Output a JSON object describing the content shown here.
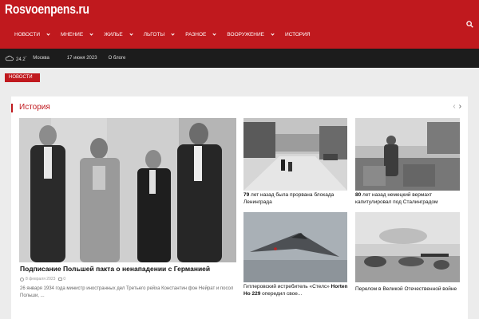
{
  "header": {
    "logo": "Rosvoenpens.ru",
    "nav": [
      {
        "label": "Новости",
        "has_submenu": true
      },
      {
        "label": "Мнение",
        "has_submenu": true
      },
      {
        "label": "Жилье",
        "has_submenu": true
      },
      {
        "label": "Льготы",
        "has_submenu": true
      },
      {
        "label": "Разное",
        "has_submenu": true
      },
      {
        "label": "Вооружение",
        "has_submenu": true
      },
      {
        "label": "История",
        "has_submenu": false
      }
    ],
    "search_icon": "search-icon"
  },
  "topbar": {
    "weather_icon": "cloud-icon",
    "temperature": "24.2",
    "degree": "°",
    "city": "Москва",
    "date": "17 июня 2023",
    "about": "О блоге"
  },
  "ticker": {
    "label": "Новости"
  },
  "section": {
    "title": "История",
    "prev_icon": "chevron-left-icon",
    "next_icon": "chevron-right-icon",
    "featured": {
      "title": "Подписание Польшей пакта о ненападении с Германией",
      "date": "8 февраля 2023",
      "comments": "0",
      "excerpt": "26 января 1934 года министр иностранных дел Третьего рейха Константин фон Нейрат и посол Польши, ..."
    },
    "cards": [
      {
        "title_bold": "79",
        "title_rest": " лет назад была прорвана блокада Ленинграда"
      },
      {
        "title_bold": "80",
        "title_rest": " лет назад немецкий вермахт капитулировал под Сталинградом"
      },
      {
        "title_rest": "Гитлеровский истребитель «Стелс» ",
        "title_bold2": "Horten Ho 229",
        "title_tail": " опередил свое..."
      },
      {
        "title_rest": "Перелом в Великой Отечественной войне"
      }
    ]
  },
  "colors": {
    "brand": "#c0191e",
    "topbar": "#1c1c1c",
    "background": "#ececec"
  }
}
